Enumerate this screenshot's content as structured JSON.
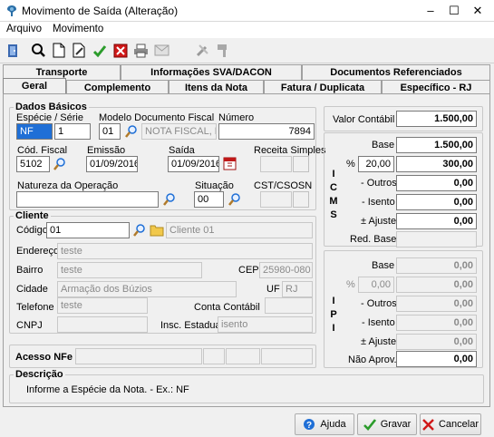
{
  "window": {
    "title": "Movimento de Saída (Alteração)",
    "minimize": "–",
    "maximize": "☐",
    "close": "✕"
  },
  "menu": {
    "arquivo": "Arquivo",
    "movimento": "Movimento"
  },
  "tabs_row1": [
    "Transporte",
    "Informações SVA/DACON",
    "Documentos Referenciados"
  ],
  "tabs_row2": [
    "Geral",
    "Complemento",
    "Itens da Nota",
    "Fatura / Duplicata",
    "Específico - RJ"
  ],
  "dados": {
    "title": "Dados Básicos",
    "especie_serie_label": "Espécie  /  Série",
    "especie": "NF",
    "serie": "1",
    "modelo_label": "Modelo Documento Fiscal",
    "modelo_code": "01",
    "modelo_desc": "NOTA FISCAL, MI",
    "numero_label": "Número",
    "numero": "7894",
    "cod_fiscal_label": "Cód. Fiscal",
    "cod_fiscal": "5102",
    "emissao_label": "Emissão",
    "emissao": "01/09/2016",
    "saida_label": "Saída",
    "saida": "01/09/2016",
    "receita_label": "Receita Simples",
    "natureza_label": "Natureza da Operação",
    "natureza": "",
    "situacao_label": "Situação",
    "situacao": "00",
    "cst_label": "CST/CSOSN"
  },
  "cliente": {
    "title": "Cliente",
    "codigo_label": "Código",
    "codigo": "01",
    "nome": "Cliente 01",
    "endereco_label": "Endereço",
    "endereco": "teste",
    "bairro_label": "Bairro",
    "bairro": "teste",
    "cep_label": "CEP",
    "cep": "25980-080",
    "cidade_label": "Cidade",
    "cidade": "Armação dos Búzios",
    "uf_label": "UF",
    "uf": "RJ",
    "telefone_label": "Telefone",
    "telefone": "teste",
    "conta_label": "Conta Contábil",
    "cnpj_label": "CNPJ",
    "insc_label": "Insc. Estadual",
    "insc": "isento"
  },
  "acesso": {
    "label": "Acesso NFe"
  },
  "descricao": {
    "title": "Descrição",
    "text": "Informe a Espécie da Nota. - Ex.: NF"
  },
  "totais": {
    "valor_contabil_label": "Valor Contábil",
    "valor_contabil": "1.500,00",
    "icms_label": "I C M S",
    "icms": {
      "base_label": "Base",
      "base": "1.500,00",
      "pct_label": "%",
      "pct": "20,00",
      "valor": "300,00",
      "outros_label": "- Outros",
      "outros": "0,00",
      "isento_label": "- Isento",
      "isento": "0,00",
      "ajuste_label": "± Ajuste",
      "ajuste": "0,00",
      "red_base_label": "Red. Base",
      "red_base": ""
    },
    "ipi_label": "I P I",
    "ipi": {
      "base_label": "Base",
      "base": "0,00",
      "pct_label": "%",
      "pct": "0,00",
      "valor": "0,00",
      "outros_label": "- Outros",
      "outros": "0,00",
      "isento_label": "- Isento",
      "isento": "0,00",
      "ajuste_label": "± Ajuste",
      "ajuste": "0,00",
      "nao_aprov_label": "Não Aprov.",
      "nao_aprov": "0,00"
    }
  },
  "buttons": {
    "ajuda": "Ajuda",
    "gravar": "Gravar",
    "cancelar": "Cancelar"
  },
  "colors": {
    "accent_blue": "#1f6fd6",
    "icon_green": "#2c9c2c",
    "icon_red": "#d01818",
    "inactive_border": "#c8c8c8"
  }
}
